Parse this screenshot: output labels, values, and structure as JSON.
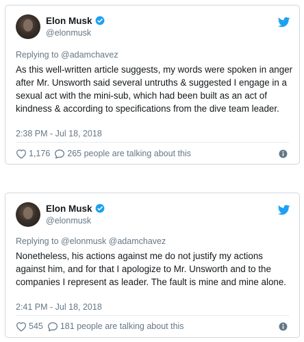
{
  "tweets": [
    {
      "author_name": "Elon Musk",
      "author_handle": "@elonmusk",
      "replying_to": "Replying to @adamchavez",
      "text": "As this well-written article suggests, my words were spoken in anger after Mr. Unsworth said several untruths & suggested I engage in a sexual act with the mini-sub, which had been built as an act of kindness & according to specifications from the dive team leader.",
      "timestamp": "2:38 PM - Jul 18, 2018",
      "likes": "1,176",
      "talking": "265 people are talking about this"
    },
    {
      "author_name": "Elon Musk",
      "author_handle": "@elonmusk",
      "replying_to": "Replying to @elonmusk @adamchavez",
      "text": "Nonetheless, his actions against me do not justify my actions against him, and for that I apologize to Mr. Unsworth and to the companies I represent as leader. The fault is mine and mine alone.",
      "timestamp": "2:41 PM - Jul 18, 2018",
      "likes": "545",
      "talking": "181 people are talking about this"
    }
  ],
  "icons": {
    "verified": "verified-badge-icon",
    "brand": "twitter-bird-icon",
    "like": "heart-icon",
    "comment": "comment-bubble-icon",
    "info": "info-icon"
  },
  "colors": {
    "twitter_blue": "#1da1f2",
    "secondary_text": "#657786",
    "primary_text": "#14171a",
    "border": "#d0d6db"
  }
}
